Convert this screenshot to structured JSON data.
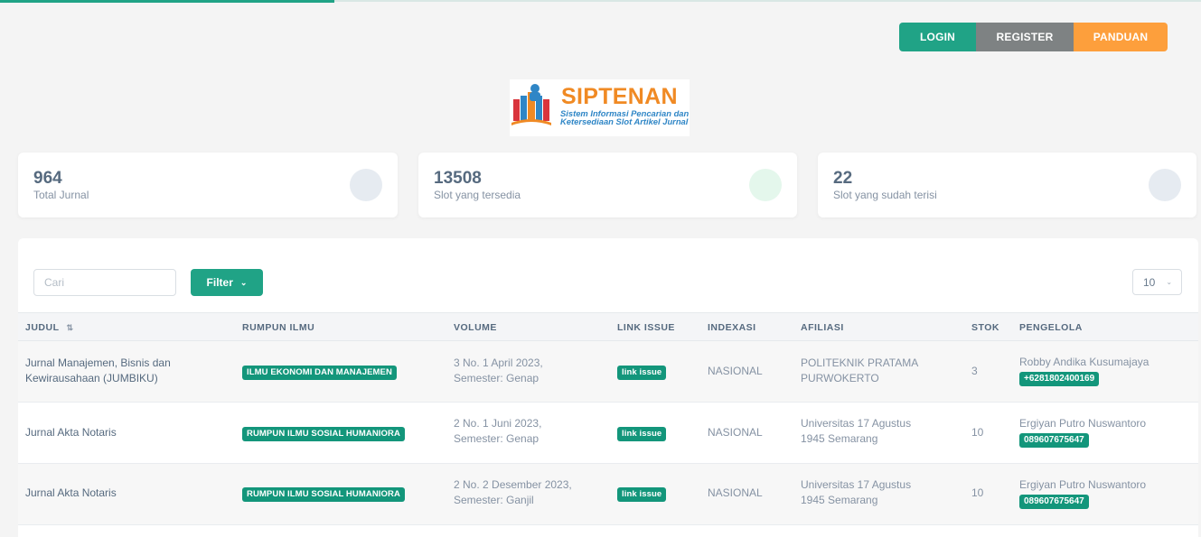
{
  "nav": {
    "login": "LOGIN",
    "register": "REGISTER",
    "panduan": "PANDUAN"
  },
  "logo": {
    "title": "SIPTENAN",
    "subtitle": "Sistem Informasi Pencarian dan Ketersediaan Slot Artikel Jurnal"
  },
  "stats": [
    {
      "value": "964",
      "label": "Total Jurnal",
      "circle_color": "#e6ebf1"
    },
    {
      "value": "13508",
      "label": "Slot yang tersedia",
      "circle_color": "#e4f7ec"
    },
    {
      "value": "22",
      "label": "Slot yang sudah terisi",
      "circle_color": "#e6ebf1"
    }
  ],
  "toolbar": {
    "search_placeholder": "Cari",
    "filter_label": "Filter",
    "per_page": "10"
  },
  "table": {
    "headers": {
      "judul": "JUDUL",
      "rumpun": "RUMPUN ILMU",
      "volume": "VOLUME",
      "link": "LINK ISSUE",
      "indexasi": "INDEXASI",
      "afiliasi": "AFILIASI",
      "stok": "STOK",
      "pengelola": "PENGELOLA"
    },
    "rows": [
      {
        "judul_1": "Jurnal Manajemen, Bisnis dan",
        "judul_2": "Kewirausahaan (JUMBIKU)",
        "rumpun": "ILMU EKONOMI DAN MANAJEMEN",
        "volume_1": "3 No. 1 April 2023,",
        "volume_2": "Semester: Genap",
        "link": "link issue",
        "indexasi": "NASIONAL",
        "afiliasi_1": "POLITEKNIK PRATAMA",
        "afiliasi_2": "PURWOKERTO",
        "stok": "3",
        "pengelola": "Robby Andika Kusumajaya",
        "phone": "+6281802400169"
      },
      {
        "judul_1": "Jurnal Akta Notaris",
        "judul_2": "",
        "rumpun": "RUMPUN ILMU SOSIAL HUMANIORA",
        "volume_1": "2 No. 1 Juni 2023,",
        "volume_2": "Semester: Genap",
        "link": "link issue",
        "indexasi": "NASIONAL",
        "afiliasi_1": "Universitas 17 Agustus",
        "afiliasi_2": "1945 Semarang",
        "stok": "10",
        "pengelola": "Ergiyan Putro Nuswantoro",
        "phone": "089607675647"
      },
      {
        "judul_1": "Jurnal Akta Notaris",
        "judul_2": "",
        "rumpun": "RUMPUN ILMU SOSIAL HUMANIORA",
        "volume_1": "2 No. 2 Desember 2023,",
        "volume_2": "Semester: Ganjil",
        "link": "link issue",
        "indexasi": "NASIONAL",
        "afiliasi_1": "Universitas 17 Agustus",
        "afiliasi_2": "1945 Semarang",
        "stok": "10",
        "pengelola": "Ergiyan Putro Nuswantoro",
        "phone": "089607675647"
      }
    ]
  },
  "icons": {
    "sort": "sort-icon",
    "chevron": "chevron-down-icon"
  }
}
